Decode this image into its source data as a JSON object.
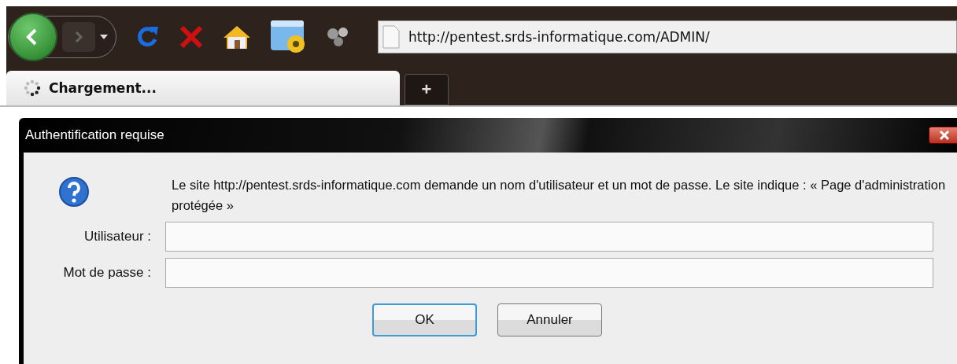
{
  "browser": {
    "address": "http://pentest.srds-informatique.com/ADMIN/",
    "tabs": [
      {
        "label": "Chargement...",
        "selected": true
      }
    ],
    "new_tab": "+"
  },
  "dialog": {
    "title": "Authentification requise",
    "message": "Le site http://pentest.srds-informatique.com demande un nom d'utilisateur et un mot de passe. Le site indique : « Page d'administration protégée »",
    "fields": [
      {
        "label": "Utilisateur :"
      },
      {
        "label": "Mot de passe :"
      }
    ],
    "buttons": [
      {
        "label": "OK",
        "default": true
      },
      {
        "label": "Annuler",
        "default": false
      }
    ]
  }
}
